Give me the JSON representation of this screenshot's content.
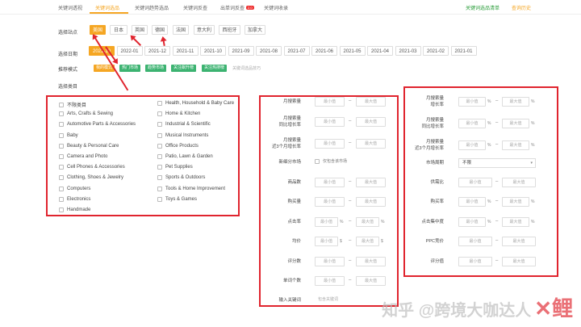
{
  "nav": {
    "tabs": [
      {
        "label": "关键词透视"
      },
      {
        "label": "关键词选品"
      },
      {
        "label": "关键词趋势选品"
      },
      {
        "label": "关键词反查"
      },
      {
        "label": "出单词反查"
      },
      {
        "label": "关键词收录"
      }
    ],
    "hot_badge": "2.0",
    "right_links": [
      "关键词选品清单",
      "查询历史"
    ]
  },
  "site": {
    "label": "选择站点",
    "options": [
      "美国",
      "日本",
      "英国",
      "德国",
      "法国",
      "意大利",
      "西班牙",
      "加拿大"
    ],
    "selected": "美国"
  },
  "date": {
    "label": "选择日期",
    "options": [
      "2021-10",
      "2022-01",
      "2021-12",
      "2021-11",
      "2021-10",
      "2021-09",
      "2021-08",
      "2021-07",
      "2021-06",
      "2021-05",
      "2021-04",
      "2021-03",
      "2021-02",
      "2021-01"
    ],
    "selected": "2021-10"
  },
  "mode": {
    "label": "推荐模式",
    "options": [
      "我的模式",
      "热门市场",
      "趋势市场",
      "关注飙升榜",
      "关注热搜榜"
    ],
    "hint": "关键词选品技巧"
  },
  "category": {
    "label": "选择类目",
    "left": [
      "不限类目",
      "Arts, Crafts & Sewing",
      "Automotive Parts & Accessories",
      "Baby",
      "Beauty & Personal Care",
      "Camera and Photo",
      "Cell Phones & Accessories",
      "Clothing, Shoes & Jewelry",
      "Computers",
      "Electronics",
      "Handmade"
    ],
    "right": [
      "Health, Household & Baby Care",
      "Home & Kitchen",
      "Industrial & Scientific",
      "Musical Instruments",
      "Office Products",
      "Patio, Lawn & Garden",
      "Pet Supplies",
      "Sports & Outdoors",
      "Tools & Home Improvement",
      "Toys & Games"
    ]
  },
  "placeholders": {
    "min": "最小值",
    "max": "最大值"
  },
  "filters_mid": [
    {
      "label": "月搜索量",
      "unit": ""
    },
    {
      "label": "月搜索量\n同比增长率",
      "unit": ""
    },
    {
      "label": "月搜索量\n近3个月增长率",
      "unit": ""
    },
    {
      "label": "新细分市场",
      "checkbox": "仅包含该市场"
    },
    {
      "label": "商品数",
      "unit": ""
    },
    {
      "label": "购买量",
      "unit": ""
    },
    {
      "label": "点击率",
      "unit": "%"
    },
    {
      "label": "均价",
      "unit": "$"
    },
    {
      "label": "评分数",
      "unit": ""
    },
    {
      "label": "单词个数",
      "unit": ""
    },
    {
      "label": "输入关键词",
      "text": "包含关键词"
    }
  ],
  "filters_right": [
    {
      "label": "月搜索量\n增长率",
      "unit": "%"
    },
    {
      "label": "月搜索量\n同比增长率",
      "unit": "%"
    },
    {
      "label": "月搜索量\n近3个月增长率",
      "unit": "%"
    },
    {
      "label": "市场周期",
      "select": "不限"
    },
    {
      "label": "供需比",
      "unit": ""
    },
    {
      "label": "购买率",
      "unit": "%"
    },
    {
      "label": "点击集中度",
      "unit": "%"
    },
    {
      "label": "PPC竞价",
      "unit": ""
    },
    {
      "label": "评分值",
      "unit": ""
    }
  ],
  "watermark": "知乎 @跨境大咖达人",
  "colors": {
    "accent": "#f5a623",
    "annotation": "#e0242e",
    "green": "#3cb371"
  }
}
